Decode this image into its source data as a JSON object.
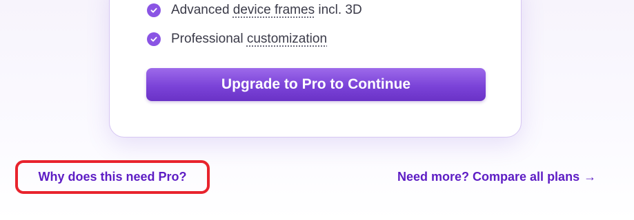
{
  "features": [
    {
      "prefix": "Advanced ",
      "highlight": "device frames",
      "suffix": " incl. 3D",
      "icon": "check-circle-icon"
    },
    {
      "prefix": "Professional ",
      "highlight": "customization",
      "suffix": "",
      "icon": "check-circle-icon"
    }
  ],
  "upgrade_button": {
    "label": "Upgrade to Pro to Continue"
  },
  "links": {
    "why_pro": "Why does this need Pro?",
    "compare_plans": "Need more? Compare all plans",
    "compare_arrow": "→"
  },
  "colors": {
    "accent": "#8a54e4",
    "button": "#7b43d8",
    "link": "#5d1cc4",
    "highlight_border": "#e8232d"
  }
}
